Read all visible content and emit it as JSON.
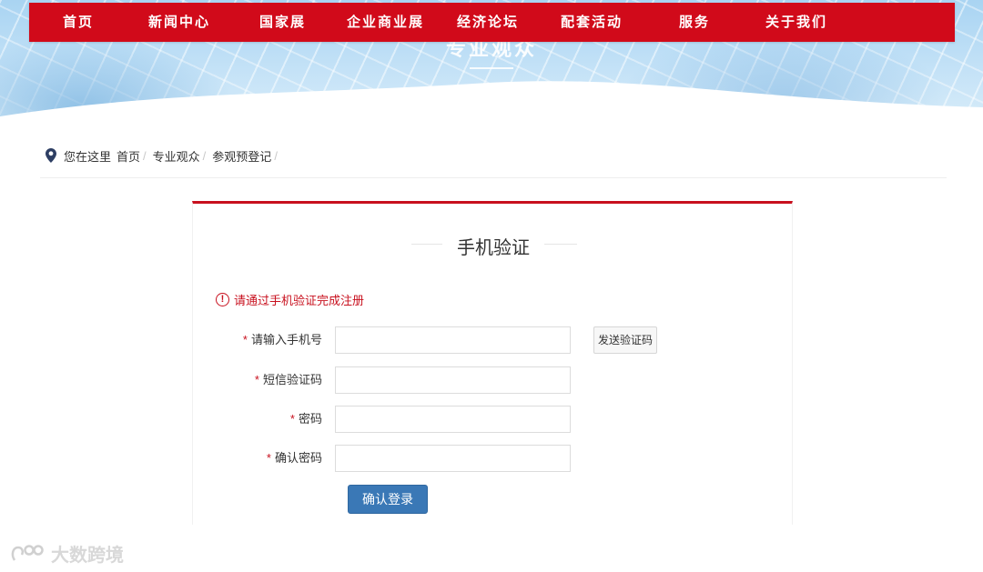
{
  "banner": {
    "title": "专业观众"
  },
  "nav": {
    "items": [
      {
        "label": "首页"
      },
      {
        "label": "新闻中心"
      },
      {
        "label": "国家展"
      },
      {
        "label": "企业商业展"
      },
      {
        "label": "经济论坛"
      },
      {
        "label": "配套活动"
      },
      {
        "label": "服务"
      },
      {
        "label": "关于我们"
      }
    ]
  },
  "breadcrumb": {
    "prefix": "您在这里",
    "items": [
      "首页",
      "专业观众",
      "参观预登记"
    ],
    "separator": "/"
  },
  "form": {
    "title": "手机验证",
    "notice": "请通过手机验证完成注册",
    "required_mark": "*",
    "fields": [
      {
        "label": "请输入手机号",
        "value": "",
        "placeholder": ""
      },
      {
        "label": "短信验证码",
        "value": "",
        "placeholder": ""
      },
      {
        "label": "密码",
        "value": "",
        "placeholder": ""
      },
      {
        "label": "确认密码",
        "value": "",
        "placeholder": ""
      }
    ],
    "send_code_label": "发送验证码",
    "submit_label": "确认登录"
  },
  "watermark": {
    "text": "大数跨境"
  },
  "colors": {
    "brand_red": "#d10a1a",
    "accent_red": "#c8101e",
    "button_blue": "#3a78b6",
    "breadcrumb_pin": "#2d3e63"
  }
}
